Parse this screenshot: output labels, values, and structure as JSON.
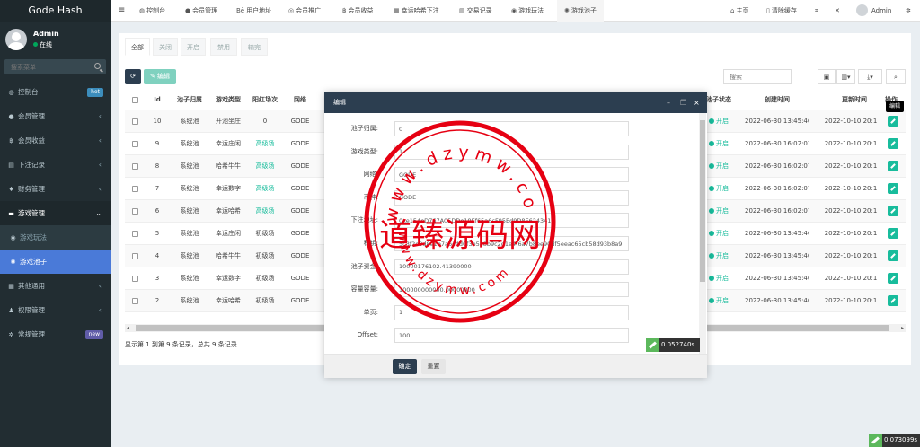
{
  "sidebar": {
    "brand": "Gode Hash",
    "user": {
      "name": "Admin",
      "status": "在线"
    },
    "search": {
      "placeholder": "搜索菜单"
    },
    "items": [
      {
        "label": "控制台",
        "badge": "hot",
        "badge_color": "#3c8dbc"
      },
      {
        "label": "会员管理"
      },
      {
        "label": "会员收益"
      },
      {
        "label": "下注记录"
      },
      {
        "label": "财务管理"
      },
      {
        "label": "游戏管理"
      },
      {
        "label": "游戏玩法"
      },
      {
        "label": "游戏池子"
      },
      {
        "label": "其他通用"
      },
      {
        "label": "权限管理"
      },
      {
        "label": "常规管理",
        "badge": "new",
        "badge_color": "#605ca8"
      }
    ]
  },
  "topbar": {
    "tabs": [
      "控制台",
      "会员管理",
      "用户地址",
      "会员推广",
      "会员收益",
      "幸运哈希下注",
      "交易记录",
      "游戏玩法",
      "游戏池子"
    ],
    "home": "主页",
    "clear_cache": "清除缓存",
    "username": "Admin"
  },
  "filter_tabs": [
    "全部",
    "关闭",
    "开启",
    "禁用",
    "输完"
  ],
  "toolbar": {
    "edit_label": "编辑",
    "search_placeholder": "搜索"
  },
  "table": {
    "columns": [
      "Id",
      "池子归属",
      "游戏类型",
      "阳红场次",
      "网络",
      "池子状态",
      "创建时间",
      "更新时间",
      "操作"
    ],
    "rows": [
      {
        "id": "10",
        "owner": "系统池",
        "type": "开池坐庄",
        "session": "0",
        "net": "GODE",
        "status": "开启",
        "created": "2022-06-30 13:45:46",
        "updated": "2022-10-10 20:1",
        "green": false
      },
      {
        "id": "9",
        "owner": "系统池",
        "type": "幸运庄闲",
        "session": "高级场",
        "net": "GODE",
        "status": "开启",
        "created": "2022-06-30 16:02:07",
        "updated": "2022-10-10 20:1",
        "green": true
      },
      {
        "id": "8",
        "owner": "系统池",
        "type": "哈希牛牛",
        "session": "高级场",
        "net": "GODE",
        "status": "开启",
        "created": "2022-06-30 16:02:07",
        "updated": "2022-10-10 20:1",
        "green": true
      },
      {
        "id": "7",
        "owner": "系统池",
        "type": "幸运数字",
        "session": "高级场",
        "net": "GODE",
        "status": "开启",
        "created": "2022-06-30 16:02:07",
        "updated": "2022-10-10 20:1",
        "green": true
      },
      {
        "id": "6",
        "owner": "系统池",
        "type": "幸运哈希",
        "session": "高级场",
        "net": "GODE",
        "status": "开启",
        "created": "2022-06-30 16:02:07",
        "updated": "2022-10-10 20:1",
        "green": true
      },
      {
        "id": "5",
        "owner": "系统池",
        "type": "幸运庄闲",
        "session": "初级场",
        "net": "GODE",
        "status": "开启",
        "created": "2022-06-30 13:45:46",
        "updated": "2022-10-10 20:1",
        "green": false
      },
      {
        "id": "4",
        "owner": "系统池",
        "type": "哈希牛牛",
        "session": "初级场",
        "net": "GODE",
        "status": "开启",
        "created": "2022-06-30 13:45:46",
        "updated": "2022-10-10 20:1",
        "green": false
      },
      {
        "id": "3",
        "owner": "系统池",
        "type": "幸运数字",
        "session": "初级场",
        "net": "GODE",
        "status": "开启",
        "created": "2022-06-30 13:45:46",
        "updated": "2022-10-10 20:1",
        "green": false
      },
      {
        "id": "2",
        "owner": "系统池",
        "type": "幸运哈希",
        "session": "初级场",
        "net": "GODE",
        "status": "开启",
        "created": "2022-06-30 13:45:46",
        "updated": "2022-10-10 20:1",
        "green": false
      }
    ],
    "footer": "显示第 1 到第 9 条记录，总共 9 条记录"
  },
  "tooltip": "编辑",
  "modal": {
    "title": "编辑",
    "fields": [
      {
        "label": "池子归属:",
        "value": "0"
      },
      {
        "label": "游戏类型:",
        "value": "1"
      },
      {
        "label": "网络:",
        "value": "GODE"
      },
      {
        "label": "币种:",
        "value": "GODE"
      },
      {
        "label": "下注地址:",
        "value": "0xe154eD767A05DDe19Ef65a6cF95Ed9D8E624341b"
      },
      {
        "label": "私钥:",
        "value": "5c3f2e9d8e1b7a6c4d0f3e5a8b9c2d1e4f6a7b8ee90df5eeac65cb58d93b8a9"
      },
      {
        "label": "池子资金:",
        "value": "10000176102.41390000"
      },
      {
        "label": "容量容量:",
        "value": "100000000000.00000000"
      },
      {
        "label": "单页:",
        "value": "1"
      },
      {
        "label": "Offset:",
        "value": "100"
      }
    ],
    "ok": "确定",
    "reset": "重置"
  },
  "timers": {
    "modal": "0.052740s",
    "page": "0.073099s"
  },
  "stamp": {
    "text": "道臻源码网",
    "url": "www.dzymw.com",
    "color": "#e60012"
  },
  "colors": {
    "sidebar": "#222d32",
    "accent": "#18bc9c",
    "active_menu": "#4a7ad8",
    "modal_header": "#2c3e50",
    "primary_btn": "#2c3e50"
  }
}
